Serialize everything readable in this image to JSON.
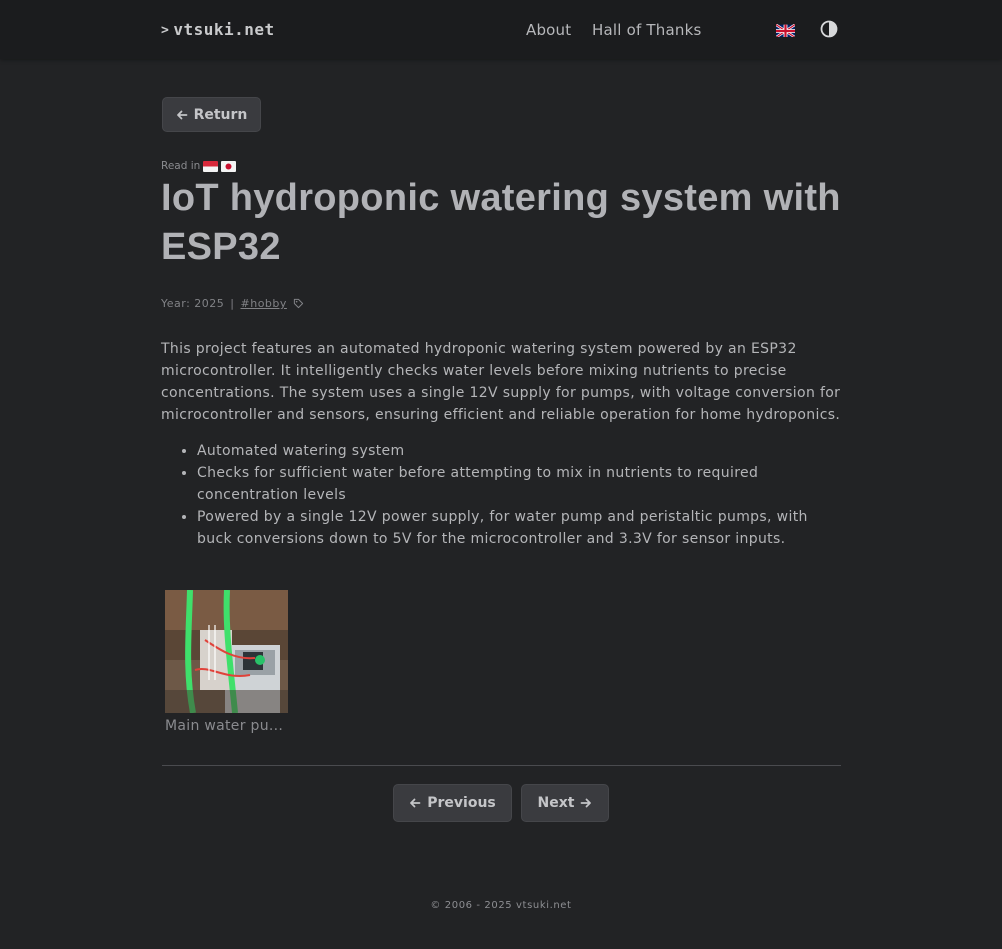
{
  "header": {
    "logo_caret": ">",
    "logo_text": "vtsuki.net",
    "nav": [
      {
        "label": "About"
      },
      {
        "label": "Hall of Thanks"
      }
    ],
    "language_icon": "uk-flag-icon",
    "theme_icon": "contrast-icon"
  },
  "return_label": "Return",
  "read_in_label": "Read in",
  "read_in_flags": [
    "indonesia-flag-icon",
    "japan-flag-icon"
  ],
  "article": {
    "title": "IoT hydroponic watering system with ESP32",
    "year_text": "Year: 2025",
    "separator": "|",
    "tag": "#hobby",
    "intro": "This project features an automated hydroponic watering system powered by an ESP32 microcontroller. It intelligently checks water levels before mixing nutrients to precise concentrations. The system uses a single 12V supply for pumps, with voltage conversion for microcontroller and sensors, ensuring efficient and reliable operation for home hydroponics.",
    "bullets": [
      "Automated watering system",
      "Checks for sufficient water before attempting to mix in nutrients to required concentration levels",
      "Powered by a single 12V power supply, for water pump and peristaltic pumps, with buck conversions down to 5V for the microcontroller and 3.3V for sensor inputs."
    ],
    "gallery_caption": "Main water pu..."
  },
  "pagination": {
    "previous_label": "Previous",
    "next_label": "Next"
  },
  "footer": {
    "copyright": "© 2006 - 2025 vtsuki.net"
  },
  "colors": {
    "background": "#222325",
    "header_bg": "#1b1c1e",
    "button_bg": "#3a3b3f",
    "text": "#b4b5b8"
  }
}
